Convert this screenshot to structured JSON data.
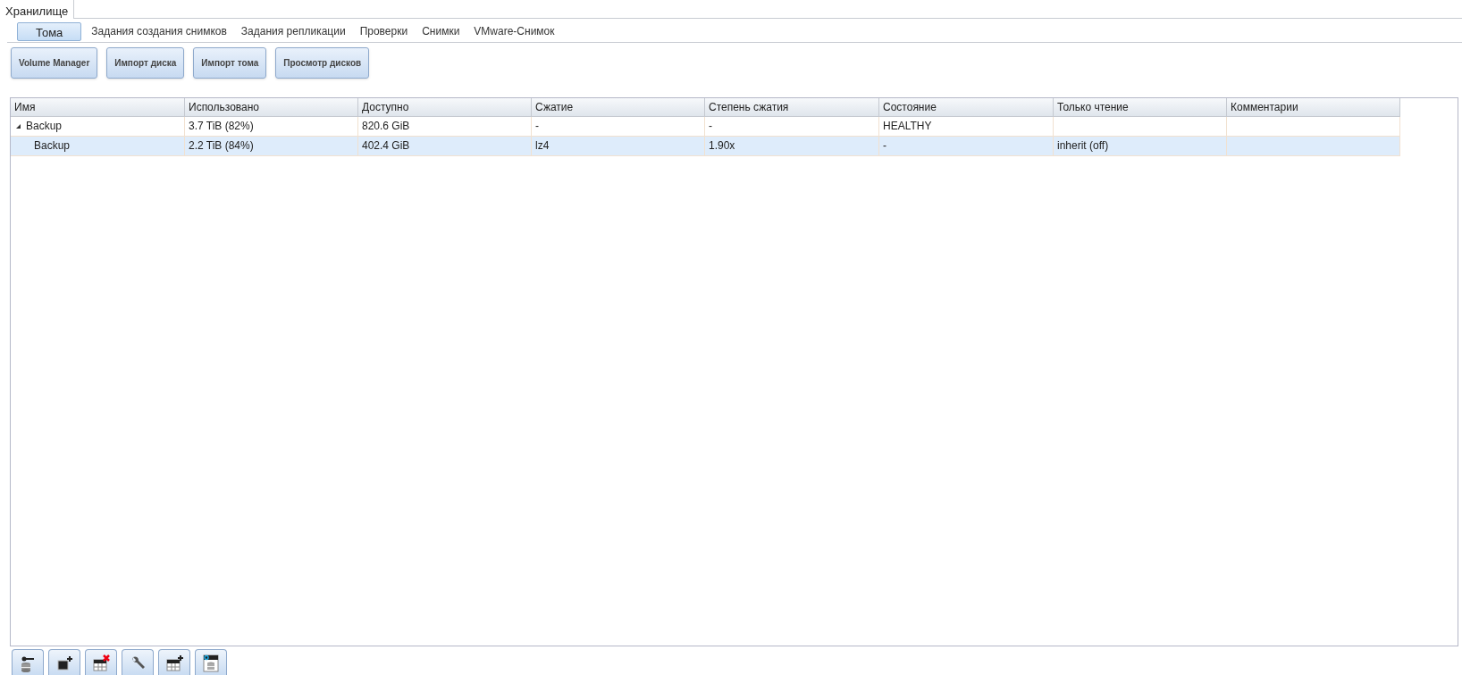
{
  "main_tab": {
    "label": "Хранилище",
    "selected": true
  },
  "tabs": [
    {
      "label": "Тома",
      "selected": true
    },
    {
      "label": "Задания создания снимков",
      "selected": false
    },
    {
      "label": "Задания репликации",
      "selected": false
    },
    {
      "label": "Проверки",
      "selected": false
    },
    {
      "label": "Снимки",
      "selected": false
    },
    {
      "label": "VMware-Снимок",
      "selected": false
    }
  ],
  "buttons": [
    "Volume Manager",
    "Импорт диска",
    "Импорт тома",
    "Просмотр дисков"
  ],
  "table": {
    "columns": [
      "Имя",
      "Использовано",
      "Доступно",
      "Сжатие",
      "Степень сжатия",
      "Состояние",
      "Только чтение",
      "Комментарии"
    ],
    "rows": [
      {
        "cells": [
          "Backup",
          "3.7 TiB (82%)",
          "820.6 GiB",
          "-",
          "-",
          "HEALTHY",
          "",
          ""
        ],
        "expanded": true,
        "selected": false,
        "children": [
          {
            "cells": [
              "Backup",
              "2.2 TiB (84%)",
              "402.4 GiB",
              "lz4",
              "1.90x",
              "-",
              "inherit (off)",
              ""
            ],
            "selected": true
          }
        ]
      }
    ]
  },
  "toolbar": [
    {
      "kind": "key-db"
    },
    {
      "kind": "add-window"
    },
    {
      "kind": "delete-table"
    },
    {
      "kind": "wrench"
    },
    {
      "kind": "add-table"
    },
    {
      "kind": "db-table"
    }
  ]
}
